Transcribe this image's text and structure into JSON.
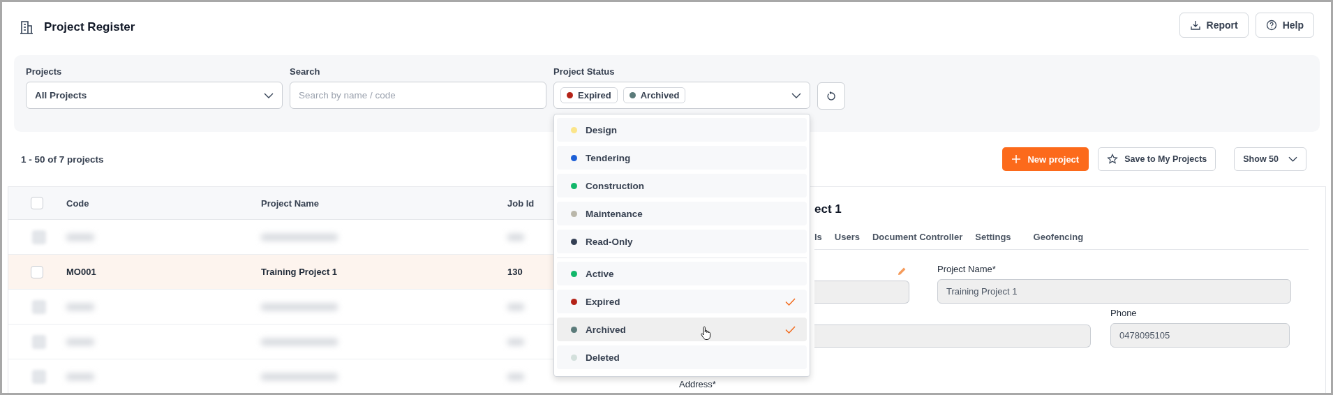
{
  "header": {
    "title": "Project Register",
    "buttons": [
      {
        "kind": "report",
        "label": "Report"
      },
      {
        "kind": "help",
        "label": "Help"
      }
    ]
  },
  "filters": {
    "projects": {
      "label": "Projects",
      "value": "All Projects"
    },
    "search": {
      "label": "Search",
      "placeholder": "Search by name / code"
    },
    "status": {
      "label": "Project Status",
      "chips": [
        {
          "label": "Expired",
          "color": "#b42318"
        },
        {
          "label": "Archived",
          "color": "#5b7b7a"
        }
      ]
    }
  },
  "status_menu": {
    "groups": [
      [
        {
          "label": "Design",
          "color": "#fbe58a",
          "checked": false,
          "highlighted": false
        },
        {
          "label": "Tendering",
          "color": "#1d5fd6",
          "checked": false,
          "highlighted": false
        },
        {
          "label": "Construction",
          "color": "#12b76a",
          "checked": false,
          "highlighted": false
        },
        {
          "label": "Maintenance",
          "color": "#bab7aa",
          "checked": false,
          "highlighted": false
        },
        {
          "label": "Read-Only",
          "color": "#344054",
          "checked": false,
          "highlighted": false
        }
      ],
      [
        {
          "label": "Active",
          "color": "#12b76a",
          "checked": false,
          "highlighted": false
        },
        {
          "label": "Expired",
          "color": "#b42318",
          "checked": true,
          "highlighted": false
        },
        {
          "label": "Archived",
          "color": "#5b7b7a",
          "checked": true,
          "highlighted": true
        },
        {
          "label": "Deleted",
          "color": "#d3e0dc",
          "checked": false,
          "highlighted": false
        }
      ]
    ]
  },
  "summary": "1 - 50 of 7 projects",
  "actions": {
    "new_project": "New project",
    "save": "Save to My Projects",
    "page_size": "Show 50"
  },
  "table": {
    "select_all_checked": false,
    "columns": [
      "Code",
      "Project Name",
      "Job Id"
    ],
    "rows": [
      {
        "blurred": true
      },
      {
        "blurred": false,
        "selected": true,
        "checked": false,
        "cells": [
          "MO001",
          "Training Project 1",
          "130"
        ]
      },
      {
        "blurred": true
      },
      {
        "blurred": true
      },
      {
        "blurred": true
      }
    ]
  },
  "detail": {
    "title": "ect 1",
    "tabs": [
      "ls",
      "Users",
      "Document Controller",
      "Settings",
      "Geofencing"
    ],
    "fields": [
      {
        "label": "Project Name*",
        "value": "Training Project 1"
      },
      {
        "label": "Phone",
        "value": "0478095105"
      }
    ],
    "address_label": "Address*"
  }
}
